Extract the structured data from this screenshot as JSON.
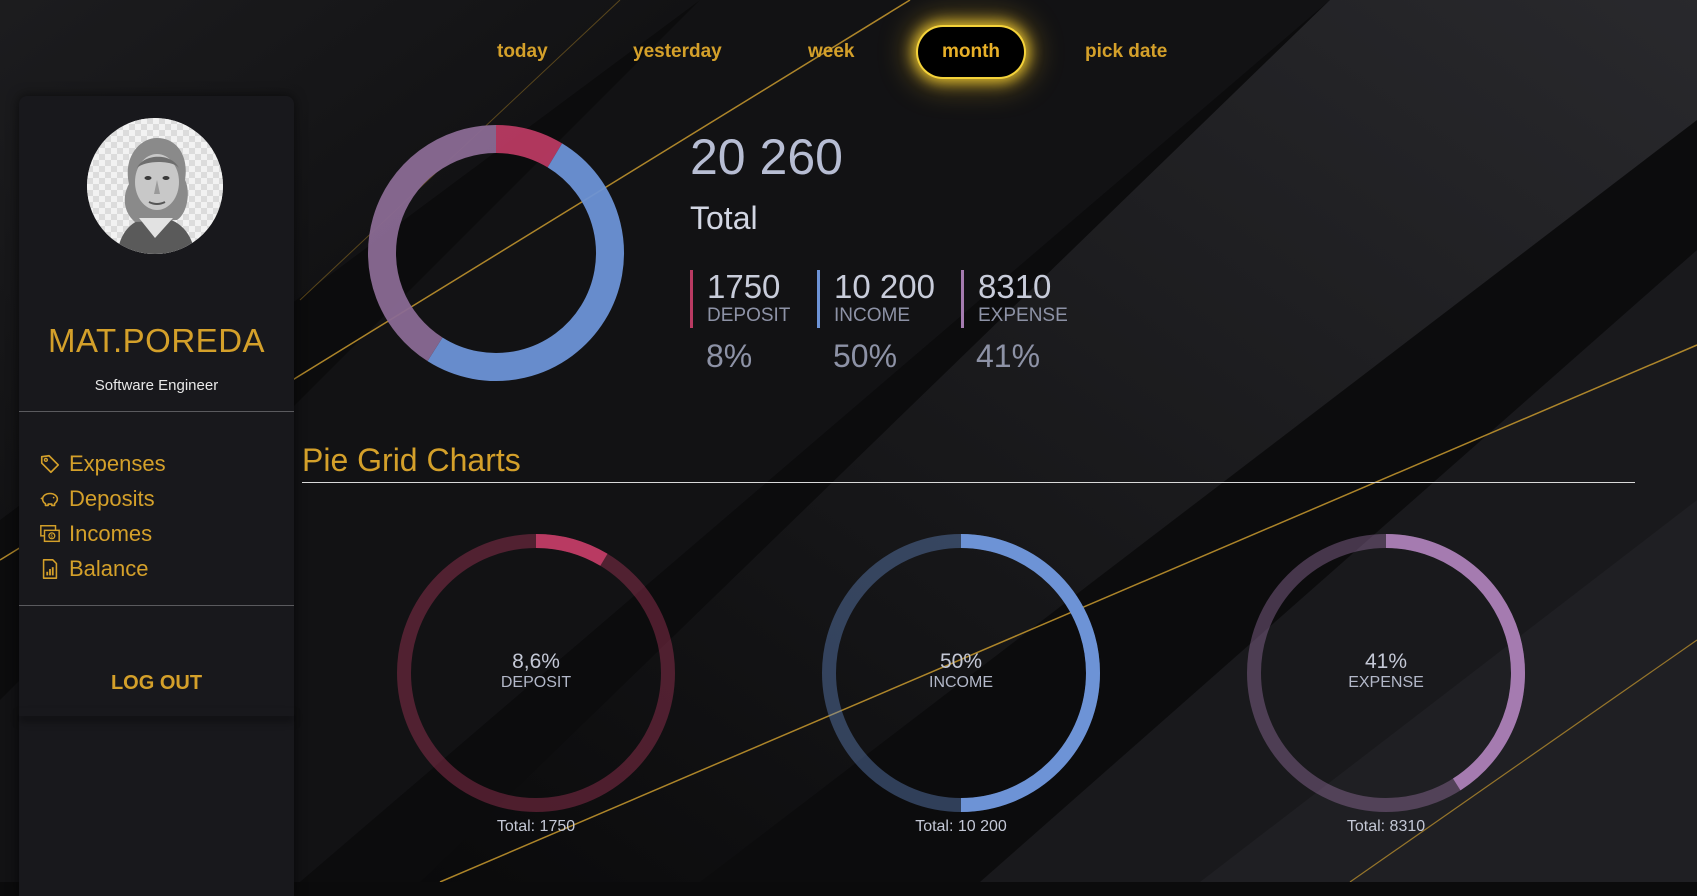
{
  "nav": {
    "items": [
      "today",
      "yesterday",
      "week",
      "month",
      "pick date"
    ],
    "active": "month"
  },
  "user": {
    "name": "MAT.POREDA",
    "role": "Software Engineer"
  },
  "menu": [
    {
      "label": "Expenses",
      "icon": "tag-icon"
    },
    {
      "label": "Deposits",
      "icon": "piggy-bank-icon"
    },
    {
      "label": "Incomes",
      "icon": "money-icon"
    },
    {
      "label": "Balance",
      "icon": "report-icon"
    }
  ],
  "logout_label": "LOG OUT",
  "summary": {
    "total": "20 260",
    "total_label": "Total",
    "stats": [
      {
        "value": "1750",
        "label": "DEPOSIT",
        "percent": "8%",
        "color": "#b93a62"
      },
      {
        "value": "10 200",
        "label": "INCOME",
        "percent": "50%",
        "color": "#6d93d6"
      },
      {
        "value": "8310",
        "label": "EXPENSE",
        "percent": "41%",
        "color": "#a57bb0"
      }
    ]
  },
  "section_title": "Pie Grid Charts",
  "pies": [
    {
      "percent": "8,6%",
      "label": "DEPOSIT",
      "total": "Total: 1750",
      "color": "#b93a62",
      "fraction": 0.086
    },
    {
      "percent": "50%",
      "label": "INCOME",
      "total": "Total: 10 200",
      "color": "#6d93d6",
      "fraction": 0.5
    },
    {
      "percent": "41%",
      "label": "EXPENSE",
      "total": "Total: 8310",
      "color": "#a57bb0",
      "fraction": 0.41
    }
  ],
  "chart_data": {
    "type": "pie",
    "categories": [
      "DEPOSIT",
      "INCOME",
      "EXPENSE"
    ],
    "values": [
      1750,
      10200,
      8310
    ],
    "colors": [
      "#b93a62",
      "#6d93d6",
      "#8a6a94"
    ],
    "title": ""
  }
}
